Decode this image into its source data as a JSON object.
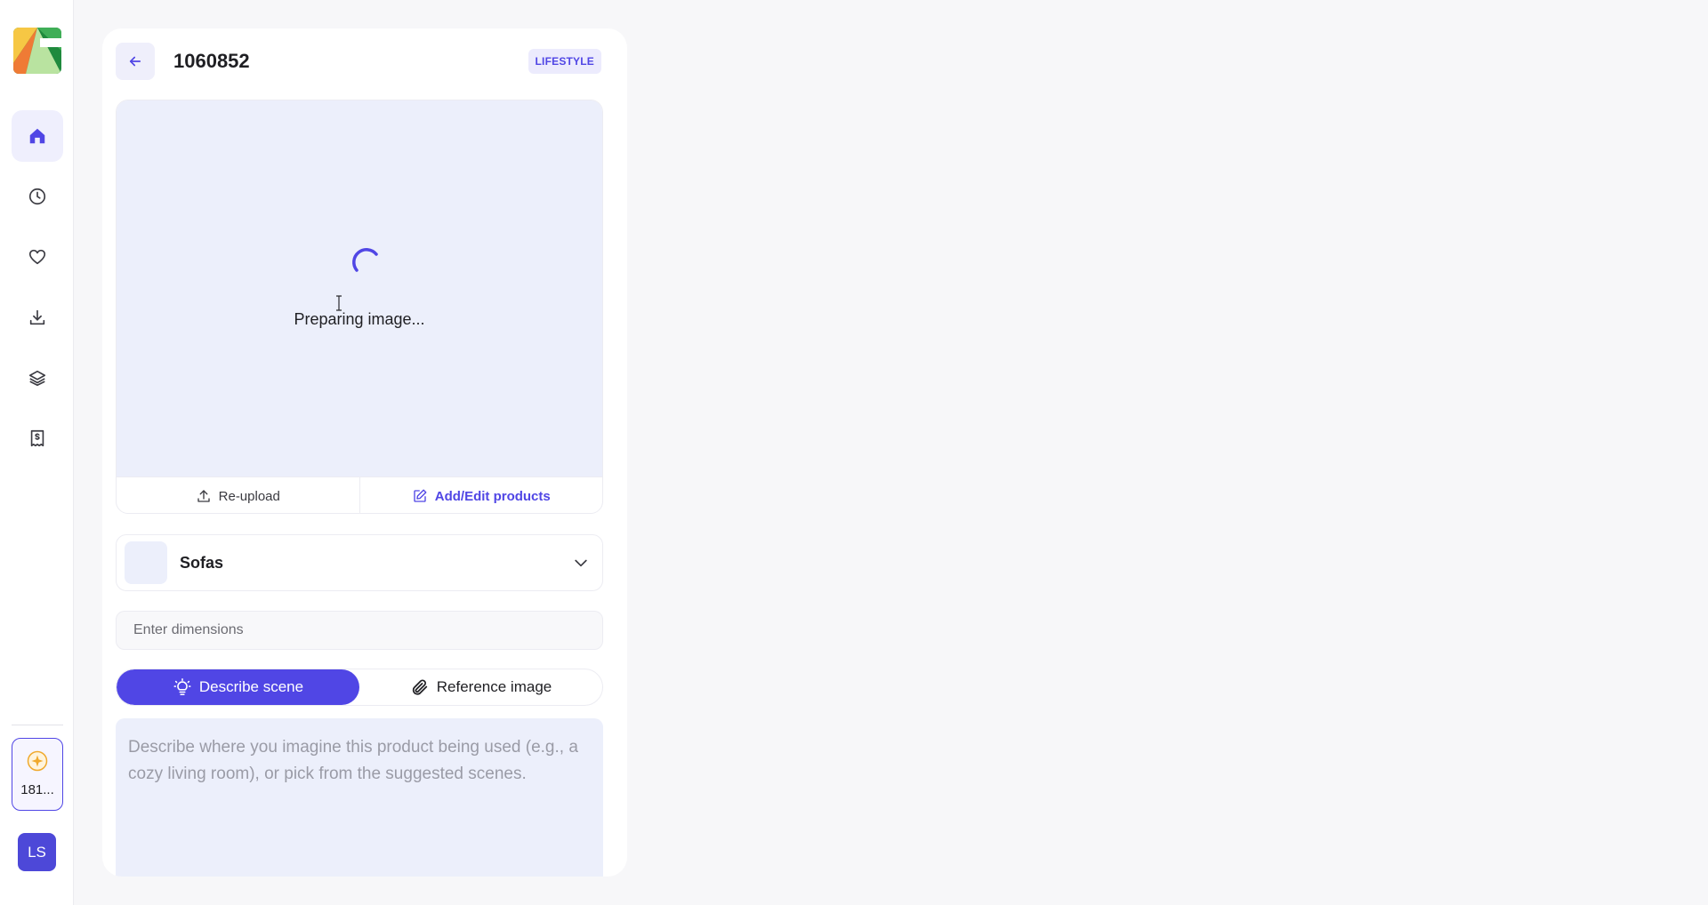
{
  "sidebar": {
    "nav": [
      {
        "icon": "home-icon",
        "active": true
      },
      {
        "icon": "clock-icon",
        "active": false
      },
      {
        "icon": "heart-icon",
        "active": false
      },
      {
        "icon": "download-icon",
        "active": false
      },
      {
        "icon": "layers-icon",
        "active": false
      },
      {
        "icon": "receipt-icon",
        "active": false
      }
    ],
    "credits": {
      "icon": "sparkle-coin-icon",
      "count": "181..."
    },
    "avatar": {
      "initials": "LS"
    }
  },
  "header": {
    "title": "1060852",
    "tag": "LIFESTYLE"
  },
  "image_card": {
    "status": "Preparing image...",
    "actions": {
      "reupload_label": "Re-upload",
      "edit_label": "Add/Edit products"
    }
  },
  "category": {
    "selected": "Sofas"
  },
  "dimensions": {
    "placeholder": "Enter dimensions",
    "value": ""
  },
  "mode": {
    "describe_label": "Describe scene",
    "reference_label": "Reference image",
    "active": "describe"
  },
  "scene": {
    "placeholder": "Describe where you imagine this product being used (e.g., a cozy living room), or pick from the suggested scenes.",
    "value": ""
  },
  "colors": {
    "accent": "#5046e5",
    "surface_tint": "#eceffb",
    "background": "#f7f7f9"
  }
}
